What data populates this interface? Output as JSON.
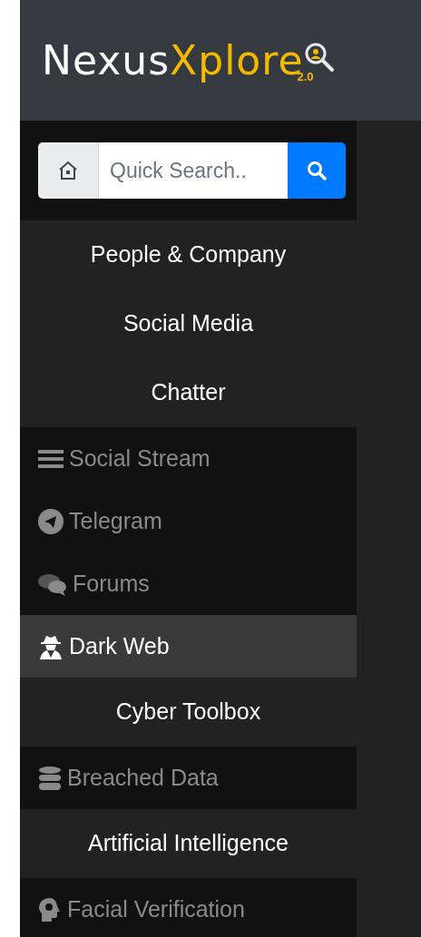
{
  "logo": {
    "primary": "Nexus",
    "accent": "Xplore",
    "version": "2.0"
  },
  "search": {
    "placeholder": "Quick Search.."
  },
  "sections": [
    {
      "heading": "People & Company"
    },
    {
      "heading": "Social Media"
    },
    {
      "heading": "Chatter",
      "items": [
        {
          "label": "Social Stream",
          "kind": "list",
          "selected": false
        },
        {
          "label": "Telegram",
          "kind": "telegram",
          "selected": false
        },
        {
          "label": "Forums",
          "kind": "comments",
          "selected": false
        },
        {
          "label": "Dark Web",
          "kind": "spy",
          "selected": true
        }
      ]
    },
    {
      "heading": "Cyber Toolbox",
      "items": [
        {
          "label": "Breached Data",
          "kind": "database",
          "selected": false
        }
      ]
    },
    {
      "heading": "Artificial Intelligence",
      "items": [
        {
          "label": "Facial Verification",
          "kind": "brain",
          "selected": false
        }
      ]
    }
  ]
}
